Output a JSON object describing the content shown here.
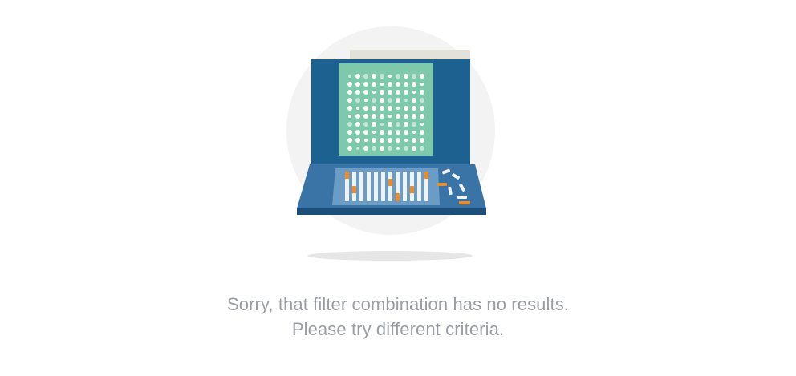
{
  "empty_state": {
    "message_line1": "Sorry, that filter combination has no results.",
    "message_line2": "Please try different criteria.",
    "illustration_icon": "laptop-with-pegboard-icon"
  },
  "colors": {
    "background": "#ffffff",
    "circle": "#f3f3f3",
    "paper": "#e2e1da",
    "laptop_screen_frame": "#1c6190",
    "screen_panel": "#7ec9ab",
    "laptop_base": "#3a73a6",
    "keyboard_area": "#6b9cc6",
    "peg_white": "#eef3f6",
    "peg_orange": "#f08a24",
    "shadow": "#e6e6e6",
    "text": "#9a9ea3"
  }
}
